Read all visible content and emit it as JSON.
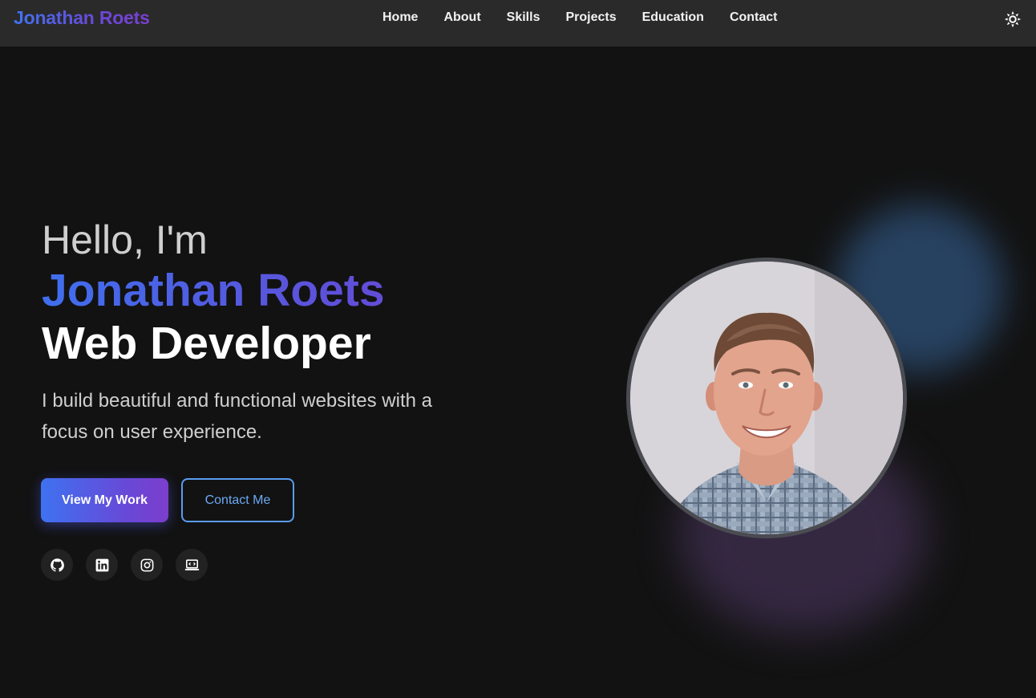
{
  "nav": {
    "brand": "Jonathan Roets",
    "links": [
      "Home",
      "About",
      "Skills",
      "Projects",
      "Education",
      "Contact"
    ],
    "theme_toggle_icon": "sun-icon"
  },
  "hero": {
    "greeting": "Hello, I'm",
    "name": "Jonathan Roets",
    "role": "Web Developer",
    "tagline": "I build beautiful and functional websites with a focus on user experience.",
    "primary_button": "View My Work",
    "secondary_button": "Contact Me",
    "socials": [
      "github-icon",
      "linkedin-icon",
      "instagram-icon",
      "portfolio-laptop-icon"
    ],
    "avatar_icon": "profile-photo"
  },
  "colors": {
    "background": "#121212",
    "navbar": "#2a2a2a",
    "accent_blue": "#3f74f0",
    "accent_purple": "#7b3fd0",
    "outline_blue": "#5b9cf0"
  }
}
